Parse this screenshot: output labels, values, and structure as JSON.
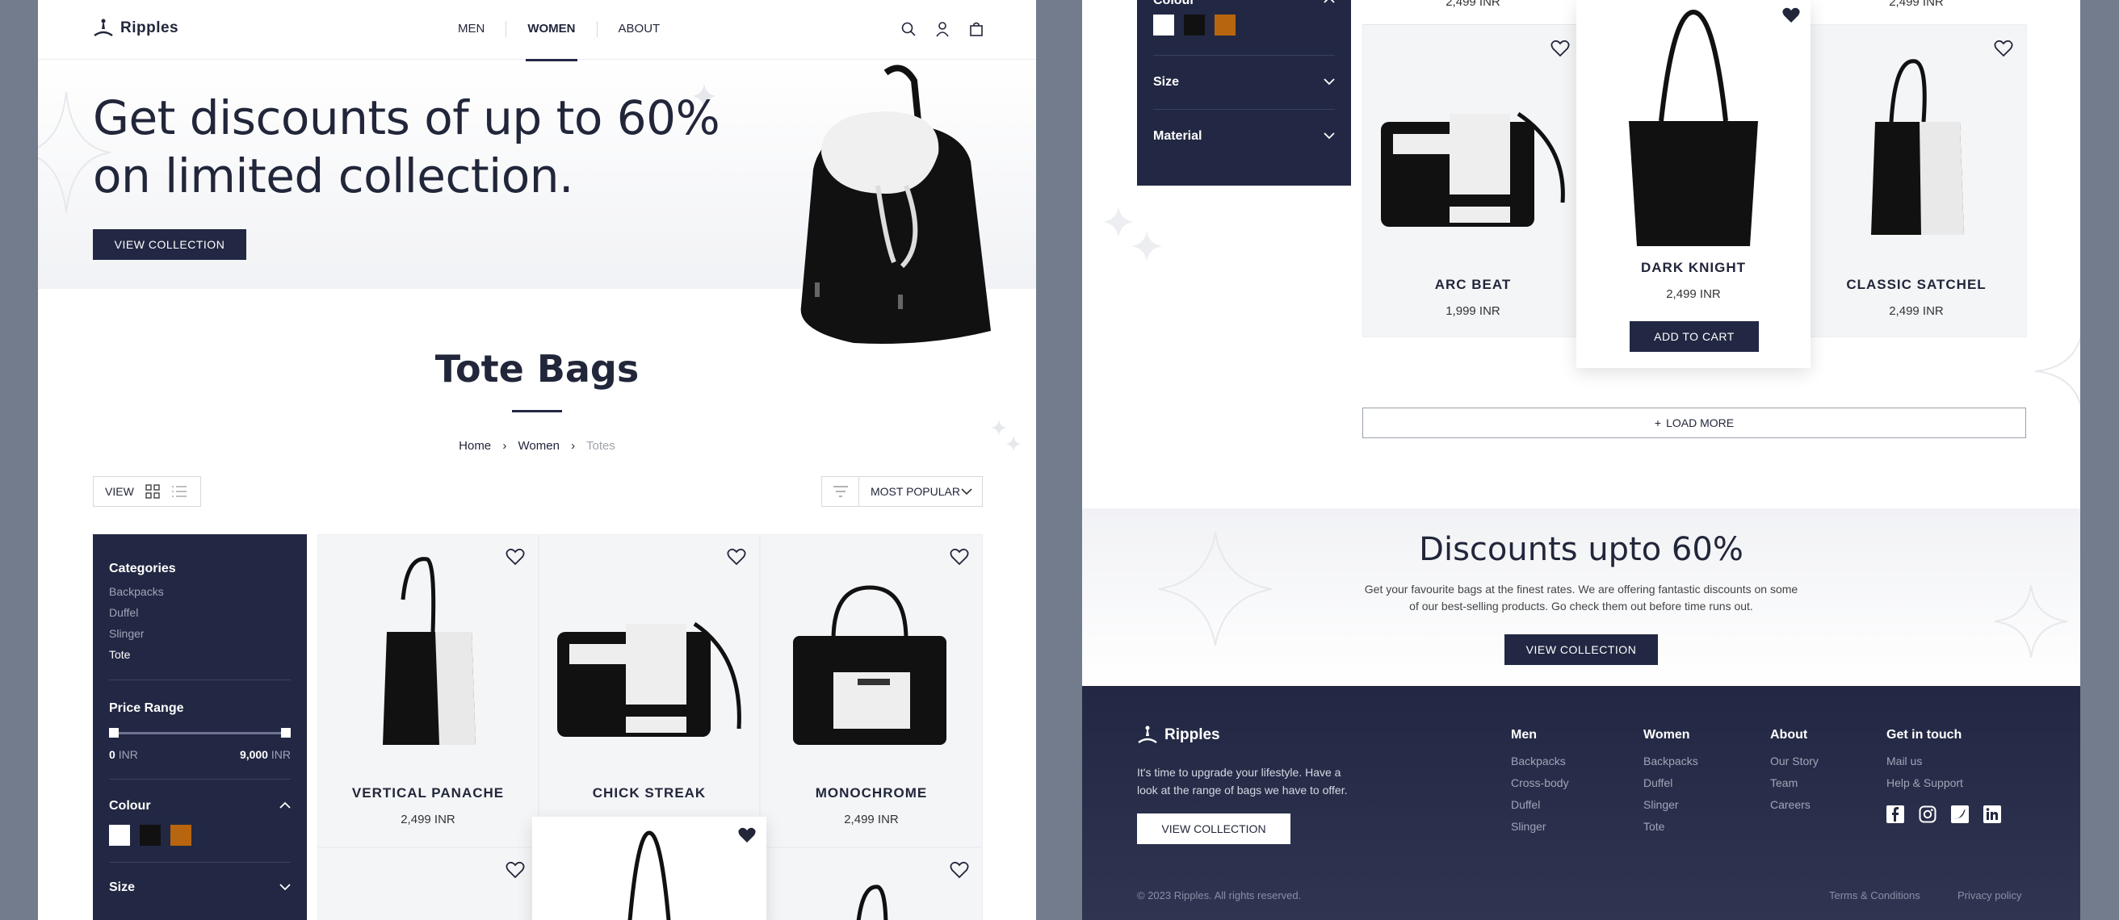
{
  "brand": "Ripples",
  "nav": [
    "MEN",
    "WOMEN",
    "ABOUT"
  ],
  "hero": {
    "title_line1": "Get discounts of up to 60%",
    "title_line2": "on limited collection.",
    "cta": "VIEW COLLECTION"
  },
  "page": {
    "title": "Tote Bags",
    "breadcrumb": [
      "Home",
      "Women",
      "Totes"
    ]
  },
  "toolbar": {
    "view_label": "VIEW",
    "sort_label": "MOST POPULAR"
  },
  "filters": {
    "categories_title": "Categories",
    "categories": [
      "Backpacks",
      "Duffel",
      "Slinger",
      "Tote"
    ],
    "selected_category": "Tote",
    "price_title": "Price Range",
    "price_min": "0",
    "price_max": "9,000",
    "currency": "INR",
    "colour_title": "Colour",
    "colours": [
      "#ffffff",
      "#111111",
      "#b8650f"
    ],
    "size_title": "Size",
    "material_title": "Material"
  },
  "products_top": [
    {
      "name": "VERTICAL PANACHE",
      "price": "2,499 INR"
    },
    {
      "name": "CHICK STREAK",
      "price": ""
    },
    {
      "name": "MONOCHROME",
      "price": "2,499 INR"
    }
  ],
  "products_second": [
    {
      "name": "ARC BEAT",
      "price": "1,999 INR"
    },
    {
      "name": "DARK KNIGHT",
      "price": "2,499 INR"
    },
    {
      "name": "CLASSIC SATCHEL",
      "price": "2,499 INR"
    }
  ],
  "partial_prices": [
    "2,499 INR",
    "2,499 INR"
  ],
  "add_to_cart": "ADD TO CART",
  "load_more": "LOAD MORE",
  "discount": {
    "title": "Discounts upto 60%",
    "text_line1": "Get your favourite bags at the finest rates. We are offering fantastic discounts on some",
    "text_line2": "of our best-selling products. Go check them out before time runs out.",
    "cta": "VIEW COLLECTION"
  },
  "footer": {
    "tagline_line1": "It's time to upgrade your lifestyle. Have a",
    "tagline_line2": "look at the range of bags we have to offer.",
    "cta": "VIEW COLLECTION",
    "columns": [
      {
        "title": "Men",
        "links": [
          "Backpacks",
          "Cross-body",
          "Duffel",
          "Slinger"
        ]
      },
      {
        "title": "Women",
        "links": [
          "Backpacks",
          "Duffel",
          "Slinger",
          "Tote"
        ]
      },
      {
        "title": "About",
        "links": [
          "Our Story",
          "Team",
          "Careers"
        ]
      },
      {
        "title": "Get in touch",
        "links": [
          "Mail us",
          "Help & Support"
        ]
      }
    ],
    "copyright": "© 2023 Ripples. All rights reserved.",
    "terms": "Terms & Conditions",
    "privacy": "Privacy policy"
  }
}
